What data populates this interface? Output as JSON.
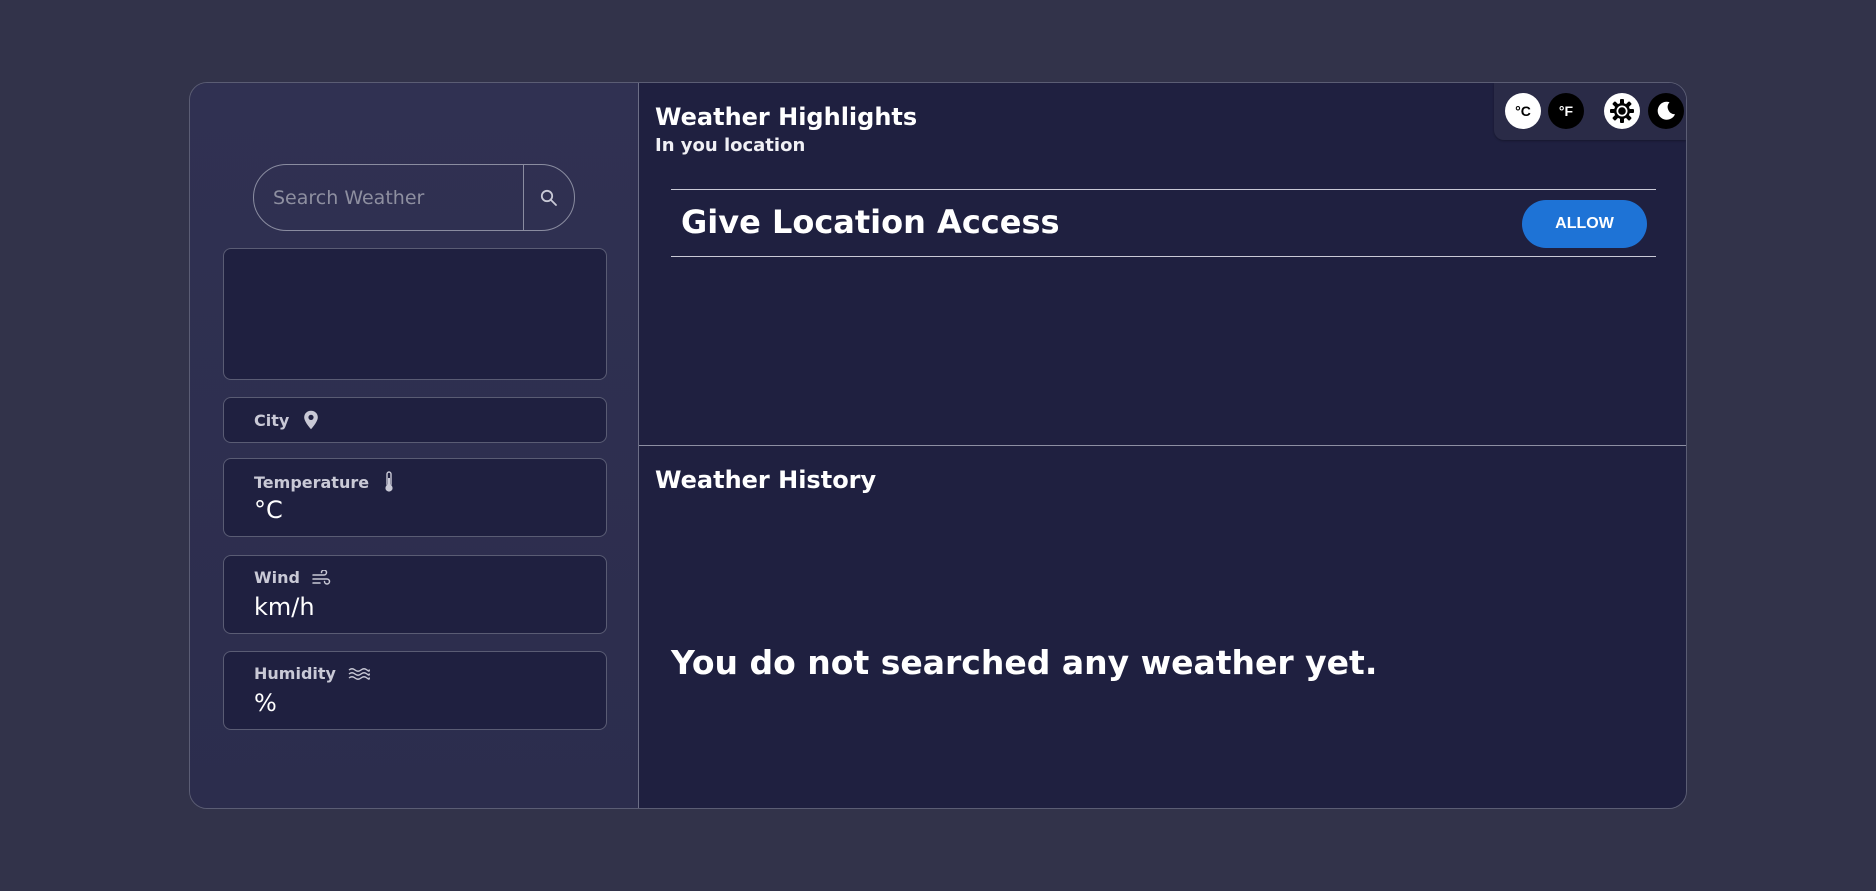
{
  "search": {
    "placeholder": "Search Weather",
    "button_icon": "search-icon"
  },
  "city": {
    "label": "City",
    "icon": "location-pin-icon"
  },
  "stats": {
    "temperature": {
      "label": "Temperature",
      "icon": "thermometer-icon",
      "unit": "°C"
    },
    "wind": {
      "label": "Wind",
      "icon": "wind-icon",
      "unit": "km/h"
    },
    "humidity": {
      "label": "Humidity",
      "icon": "humidity-waves-icon",
      "unit": "%"
    }
  },
  "highlights": {
    "title": "Weather Highlights",
    "subtitle": "In you location",
    "location_prompt": "Give Location Access",
    "allow_label": "ALLOW"
  },
  "toggles": {
    "celsius": "°C",
    "fahrenheit": "°F",
    "light_icon": "sun-gear-icon",
    "dark_icon": "moon-icon"
  },
  "history": {
    "title": "Weather History",
    "empty_message": "You do not searched any weather yet."
  },
  "colors": {
    "background": "#32334a",
    "panel": "#1f2040",
    "sidebar": "#2f3050",
    "accent": "#1e73d6",
    "text": "#ffffff"
  }
}
